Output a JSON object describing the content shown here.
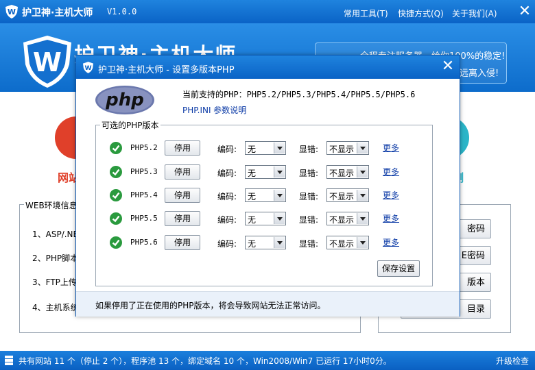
{
  "app": {
    "title": "护卫神·主机大师",
    "version": "V1.0.0",
    "menu": [
      "常用工具(T)",
      "快捷方式(Q)",
      "关于我们(A)"
    ],
    "close_glyph": "✕",
    "banner_title": "护卫神·主机大师",
    "ad_lines": [
      "，全程专注服务器，给你100%的稳定!",
      "远离入侵!"
    ]
  },
  "background": {
    "icon_labels": [
      "网站",
      "测"
    ],
    "web_env": {
      "title": "WEB环境信息",
      "items": [
        "1、ASP/.NET",
        "2、PHP脚本",
        "3、FTP上传",
        "4、主机系统"
      ]
    },
    "right_buttons": [
      "密码",
      "E密码",
      "版本",
      "目录"
    ]
  },
  "status": {
    "text": "共有网站 11 个（停止 2 个），程序池 13 个，绑定域名 10 个，Win2008/Win7 已运行 17小时0分。",
    "upgrade": "升级检查"
  },
  "dialog": {
    "title": "护卫神·主机大师 - 设置多版本PHP",
    "close_glyph": "✕",
    "logo_text": "php",
    "current_label": "当前支持的PHP：PHP5.2/PHP5.3/PHP5.4/PHP5.5/PHP5.6",
    "ini_link": "PHP.INI 参数说明",
    "group_title": "可选的PHP版本",
    "encoding_label": "编码:",
    "error_label": "显错:",
    "stop_label": "停用",
    "more_label": "更多",
    "rows": [
      {
        "name": "PHP5.2",
        "encoding": "无",
        "display_error": "不显示"
      },
      {
        "name": "PHP5.3",
        "encoding": "无",
        "display_error": "不显示"
      },
      {
        "name": "PHP5.4",
        "encoding": "无",
        "display_error": "不显示"
      },
      {
        "name": "PHP5.5",
        "encoding": "无",
        "display_error": "不显示"
      },
      {
        "name": "PHP5.6",
        "encoding": "无",
        "display_error": "不显示"
      }
    ],
    "save_label": "保存设置",
    "footer_note": "如果停用了正在使用的PHP版本，将会导致网站无法正常访问。"
  },
  "colors": {
    "title_bar": "#0a63c6",
    "check_green": "#2a9a3e",
    "link_blue": "#0b3aa6",
    "accent_red": "#e0402a",
    "accent_teal": "#2bb5c8"
  }
}
